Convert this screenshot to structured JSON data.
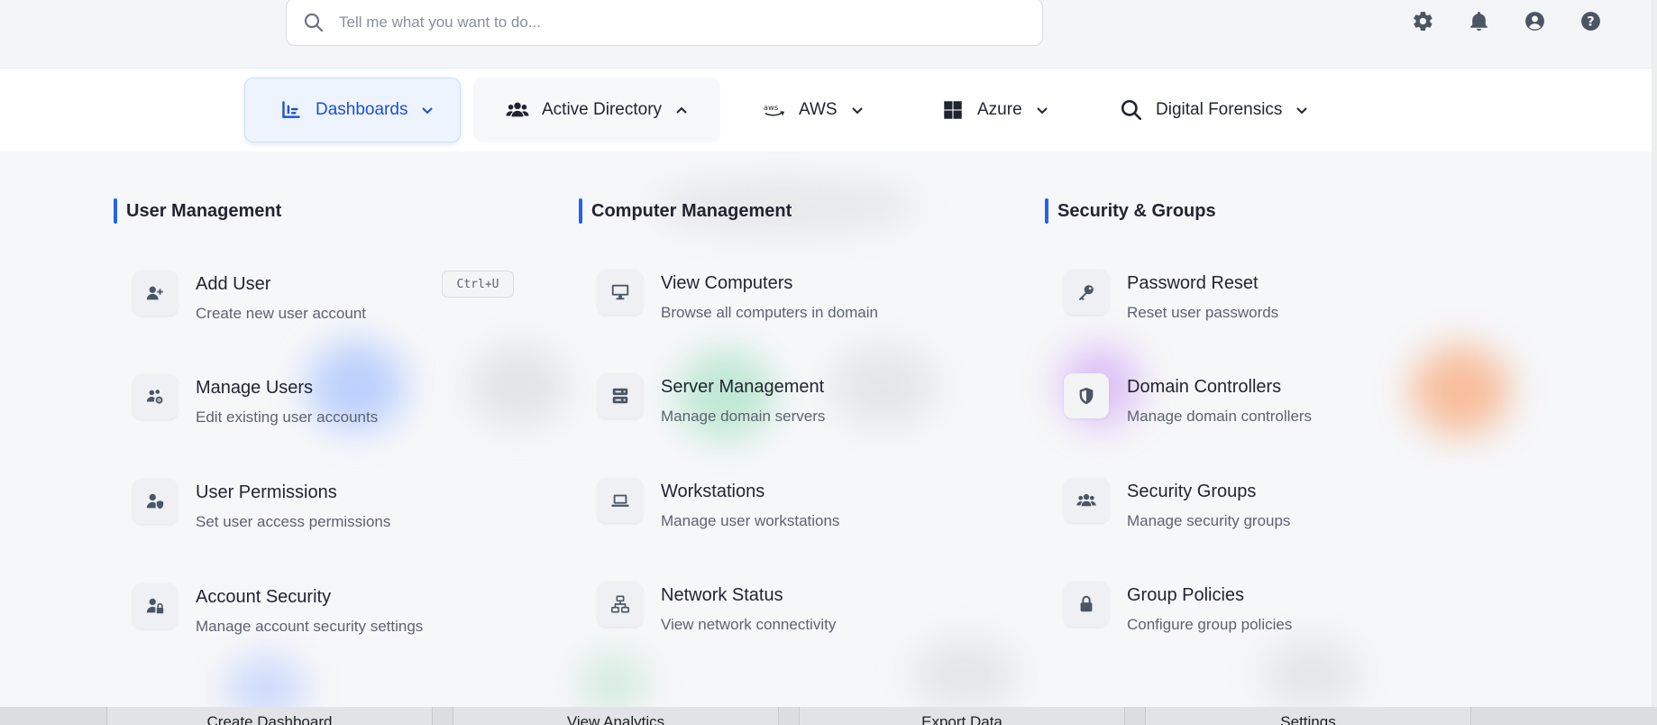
{
  "search": {
    "placeholder": "Tell me what you want to do..."
  },
  "top_icons": [
    "gear-icon",
    "bell-icon",
    "user-circle-icon",
    "help-icon"
  ],
  "nav": {
    "items": [
      {
        "label": "Dashboards",
        "icon": "chart-bar-icon",
        "state": "active"
      },
      {
        "label": "Active Directory",
        "icon": "users-icon",
        "state": "open"
      },
      {
        "label": "AWS",
        "icon": "aws-logo-icon",
        "state": ""
      },
      {
        "label": "Azure",
        "icon": "windows-logo-icon",
        "state": ""
      },
      {
        "label": "Digital Forensics",
        "icon": "magnifier-icon",
        "state": ""
      }
    ]
  },
  "menu": {
    "columns": [
      {
        "title": "User Management",
        "items": [
          {
            "title": "Add User",
            "desc": "Create new user account",
            "icon": "user-plus-icon",
            "shortcut": "Ctrl+U"
          },
          {
            "title": "Manage Users",
            "desc": "Edit existing user accounts",
            "icon": "users-cog-icon"
          },
          {
            "title": "User Permissions",
            "desc": "Set user access permissions",
            "icon": "user-shield-icon"
          },
          {
            "title": "Account Security",
            "desc": "Manage account security settings",
            "icon": "user-lock-icon"
          }
        ]
      },
      {
        "title": "Computer Management",
        "items": [
          {
            "title": "View Computers",
            "desc": "Browse all computers in domain",
            "icon": "desktop-icon"
          },
          {
            "title": "Server Management",
            "desc": "Manage domain servers",
            "icon": "server-icon"
          },
          {
            "title": "Workstations",
            "desc": "Manage user workstations",
            "icon": "laptop-icon"
          },
          {
            "title": "Network Status",
            "desc": "View network connectivity",
            "icon": "network-icon"
          }
        ]
      },
      {
        "title": "Security & Groups",
        "items": [
          {
            "title": "Password Reset",
            "desc": "Reset user passwords",
            "icon": "key-icon"
          },
          {
            "title": "Domain Controllers",
            "desc": "Manage domain controllers",
            "icon": "shield-icon"
          },
          {
            "title": "Security Groups",
            "desc": "Manage security groups",
            "icon": "group-icon"
          },
          {
            "title": "Group Policies",
            "desc": "Configure group policies",
            "icon": "lock-icon"
          }
        ]
      }
    ]
  },
  "bottom_actions": [
    "Create Dashboard",
    "View Analytics",
    "Export Data",
    "Settings"
  ],
  "colors": {
    "accent": "#2563eb",
    "nav_active_bg": "#eef4fd",
    "nav_active_text": "#1d4ed8"
  }
}
